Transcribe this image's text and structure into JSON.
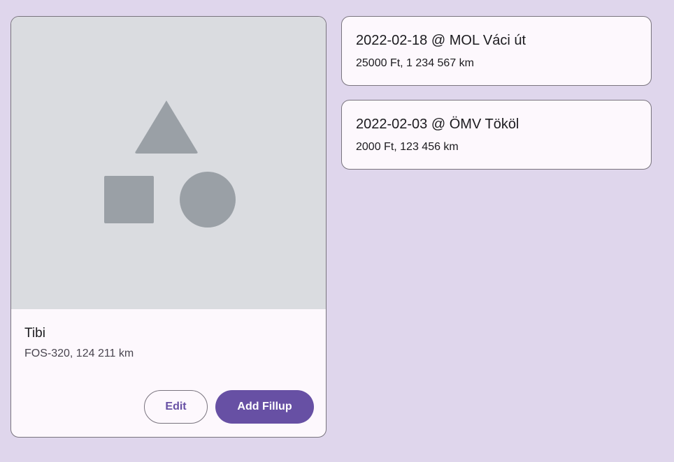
{
  "vehicle": {
    "name": "Tibi",
    "details": "FOS-320, 124 211 km",
    "image_icon": "shapes-placeholder-icon",
    "actions": {
      "edit_label": "Edit",
      "add_fillup_label": "Add Fillup"
    }
  },
  "fillups": [
    {
      "title": "2022-02-18 @ MOL Váci út",
      "details": "25000 Ft, 1 234 567 km"
    },
    {
      "title": "2022-02-03 @ ÖMV Tököl",
      "details": "2000 Ft, 123 456 km"
    }
  ],
  "colors": {
    "background": "#dfd6ec",
    "card": "#fdf8fd",
    "outline": "#79747e",
    "primary": "#6750a4",
    "media_placeholder": "#dadce0",
    "shape_fill": "#9aa0a6"
  }
}
